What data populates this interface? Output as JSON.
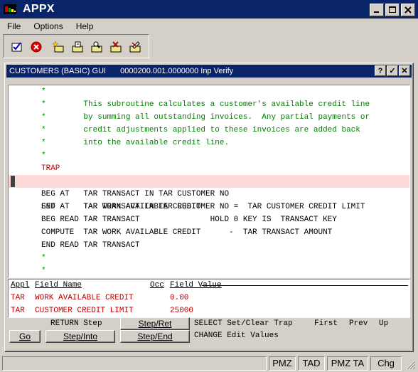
{
  "window": {
    "title": "APPX"
  },
  "menu": [
    "File",
    "Options",
    "Help"
  ],
  "toolbar": {
    "icons": [
      "check-doc-icon",
      "cancel-icon",
      "new-star-icon",
      "open-folder-icon",
      "search-folder-icon",
      "delete-folder-icon",
      "edit-folder-icon"
    ]
  },
  "inner": {
    "title": "CUSTOMERS (BASIC) GUI",
    "subtitle": "0000200.001.0000000 Inp Verify",
    "buttons": [
      "?",
      "✓",
      "✕"
    ]
  },
  "code_lines": [
    "*",
    "*        This subroutine calculates a customer's available credit line",
    "*        by summing all outstanding invoices.  Any partial payments or",
    "*        credit adjustments applied to these invoices are added back",
    "*        into the available credit line.",
    "*",
    "TRAP",
    "SET      TAR WORK AVAILABLE CREDIT       =  TAR CUSTOMER CREDIT LIMIT",
    "BEG AT   TAR TRANSACT IN TAR CUSTOMER NO",
    "END AT   TAR TRANSACT IN TAR CUSTOMER NO",
    "BEG READ TAR TRANSACT               HOLD 0 KEY IS  TRANSACT KEY",
    "COMPUTE  TAR WORK AVAILABLE CREDIT      -  TAR TRANSACT AMOUNT",
    "END READ TAR TRANSACT",
    "*",
    "*"
  ],
  "fields": {
    "headers": {
      "appl": "Appl",
      "name": "Field Name",
      "occ": "Occ",
      "value": "Field Value"
    },
    "rows": [
      {
        "appl": "TAR",
        "name": "WORK AVAILABLE CREDIT",
        "value": "0.00"
      },
      {
        "appl": "TAR",
        "name": "CUSTOMER CREDIT LIMIT",
        "value": "25000"
      }
    ]
  },
  "controls": {
    "return_step": "RETURN Step",
    "step_ret": "Step/Ret",
    "go": "Go",
    "step_into": "Step/Into",
    "step_end": "Step/End",
    "select_text": "SELECT Set/Clear Trap",
    "first": "First",
    "prev": "Prev",
    "up": "Up",
    "change_text": "CHANGE Edit Values"
  },
  "status": [
    "PMZ",
    "TAD",
    "PMZ TA",
    "Chg"
  ],
  "colors": {
    "title_bg": "#0a246a",
    "comment": "#008000",
    "trap": "#c00000",
    "highlight": "#fcdada"
  }
}
